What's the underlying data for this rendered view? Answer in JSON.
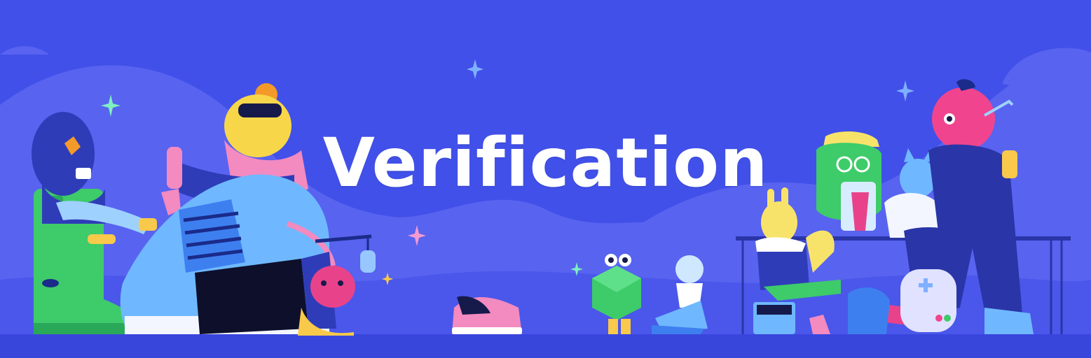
{
  "banner": {
    "title": "Verification",
    "colors": {
      "background": "#4150e8",
      "hills": "#5863f0",
      "ground": "#3946dc",
      "title": "#ffffff"
    },
    "illustration": [
      "sparkle-icon",
      "green-boot-character",
      "girl-with-phone-character",
      "sunglasses-character",
      "sneaker-character",
      "laptop-character",
      "pink-blob-character",
      "pink-shoe-character",
      "green-dice-character",
      "chess-pawn-character",
      "yellow-rabbit-character",
      "green-frog-character",
      "blue-cat-character",
      "pink-bird-character",
      "game-controller-character"
    ]
  }
}
